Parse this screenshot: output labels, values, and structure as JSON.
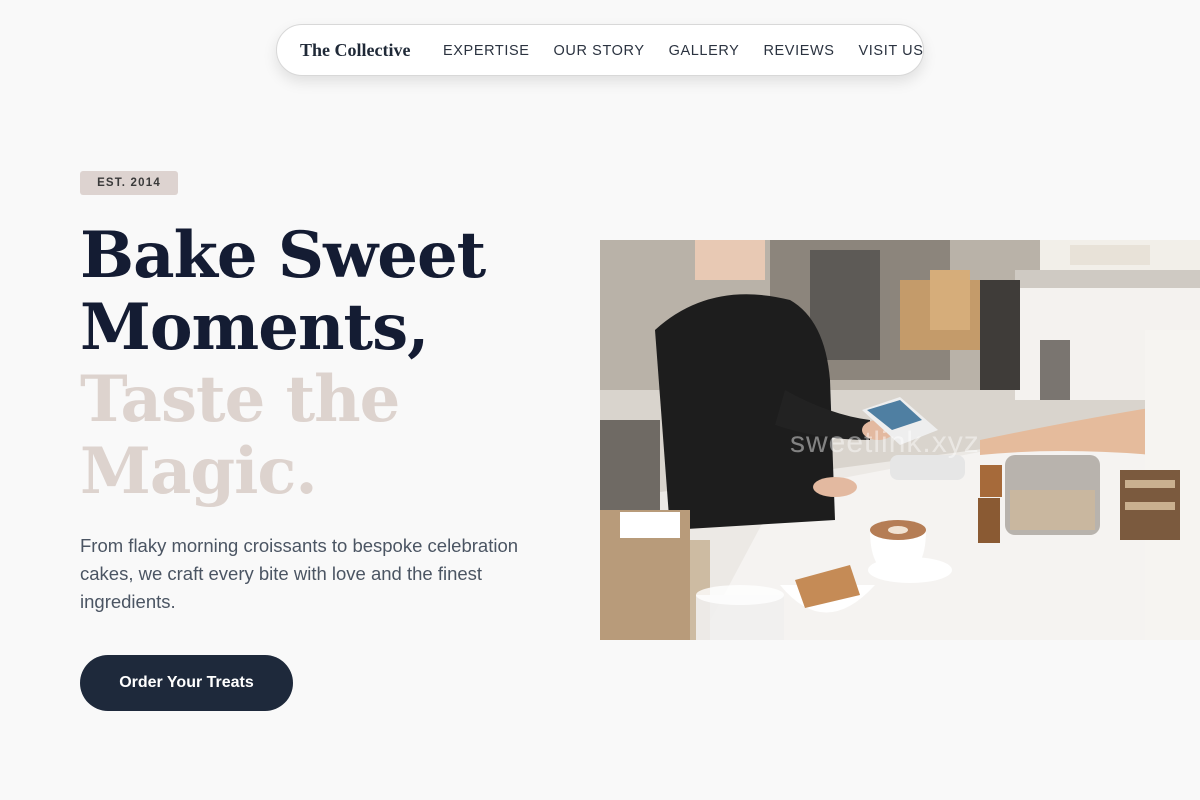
{
  "nav": {
    "brand": "The Collective",
    "links": [
      "EXPERTISE",
      "OUR STORY",
      "GALLERY",
      "REVIEWS",
      "VISIT US"
    ]
  },
  "hero": {
    "badge": "EST. 2014",
    "headline_dark_1": "Bake Sweet",
    "headline_dark_2": "Moments,",
    "headline_light_1": "Taste the",
    "headline_light_2": "Magic.",
    "description": "From flaky morning croissants to bespoke celebration cakes, we craft every bite with love and the finest ingredients.",
    "cta_label": "Order Your Treats",
    "image": {
      "watermark": "sweetlink.xyz",
      "subject": "barista-handing-card-reader-to-customer"
    }
  },
  "colors": {
    "background": "#f9f9f9",
    "heading_dark": "#141c33",
    "heading_light": "#ddd3ce",
    "badge_bg": "#ddd3d0",
    "button_bg": "#1e293b",
    "body_text": "#4b5563"
  }
}
